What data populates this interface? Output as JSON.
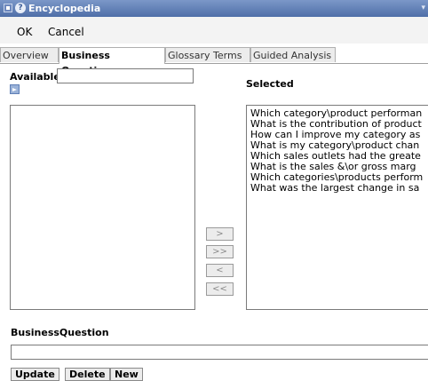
{
  "window": {
    "title": "Encyclopedia"
  },
  "menu": {
    "ok": "OK",
    "cancel": "Cancel"
  },
  "tabs": [
    {
      "label": "Overview",
      "active": false
    },
    {
      "label": "Business Questions",
      "active": true
    },
    {
      "label": "Glossary Terms",
      "active": false
    },
    {
      "label": "Guided Analysis",
      "active": false
    }
  ],
  "available": {
    "label": "Available",
    "value": "",
    "items": []
  },
  "selected": {
    "label": "Selected",
    "items": [
      "Which category\\product performan",
      "What is the contribution of product",
      "How can I improve my category as",
      "What is my category\\product chan",
      "Which sales outlets had the greate",
      "What is the sales &\\or gross marg",
      "Which categories\\products perform",
      "What was the largest change in sa"
    ]
  },
  "move_buttons": {
    "add": ">",
    "add_all": ">>",
    "remove": "<",
    "remove_all": "<<"
  },
  "business_question": {
    "label": "BusinessQuestion",
    "value": ""
  },
  "actions": {
    "update": "Update",
    "delete": "Delete",
    "new": "New"
  }
}
